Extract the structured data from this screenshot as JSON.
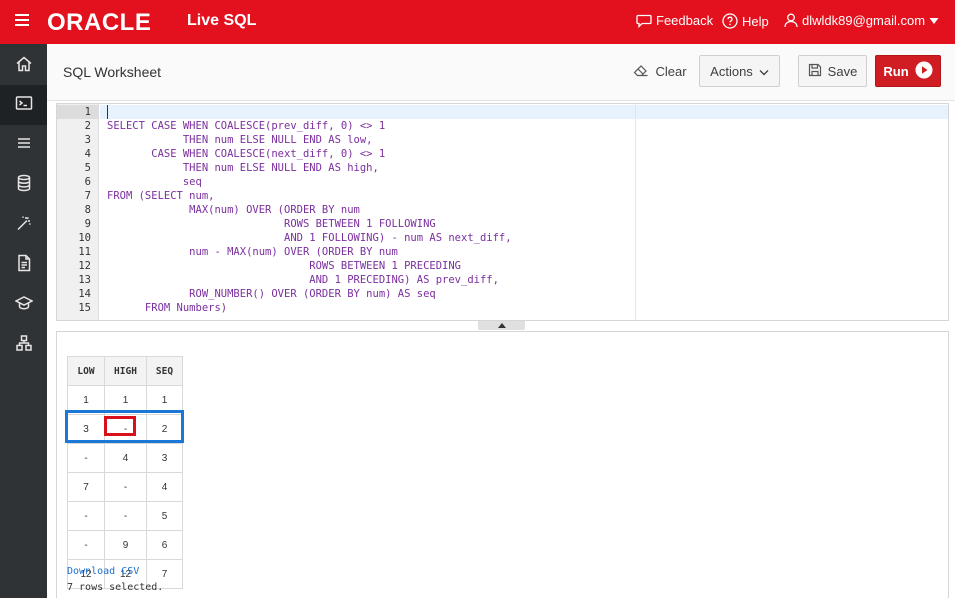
{
  "topbar": {
    "logo": "ORACLE",
    "product": "Live SQL",
    "feedback": "Feedback",
    "help": "Help",
    "user": "dlwldk89@gmail.com"
  },
  "sidebar": {
    "items": [
      "home-icon",
      "terminal-icon",
      "list-icon",
      "database-icon",
      "magic-wand-icon",
      "document-icon",
      "graduation-cap-icon",
      "schema-icon"
    ],
    "active_index": 1
  },
  "header": {
    "title": "SQL Worksheet",
    "clear_label": "Clear",
    "actions_label": "Actions",
    "save_label": "Save",
    "run_label": "Run"
  },
  "editor": {
    "line_numbers": [
      "1",
      "2",
      "3",
      "4",
      "5",
      "6",
      "7",
      "8",
      "9",
      "10",
      "11",
      "12",
      "13",
      "14",
      "15"
    ],
    "lines": [
      "",
      "SELECT CASE WHEN COALESCE(prev_diff, 0) <> 1",
      "            THEN num ELSE NULL END AS low,",
      "       CASE WHEN COALESCE(next_diff, 0) <> 1",
      "            THEN num ELSE NULL END AS high,",
      "            seq",
      "FROM (SELECT num,",
      "             MAX(num) OVER (ORDER BY num",
      "                            ROWS BETWEEN 1 FOLLOWING",
      "                            AND 1 FOLLOWING) - num AS next_diff,",
      "             num - MAX(num) OVER (ORDER BY num",
      "                                ROWS BETWEEN 1 PRECEDING",
      "                                AND 1 PRECEDING) AS prev_diff,",
      "             ROW_NUMBER() OVER (ORDER BY num) AS seq",
      "      FROM Numbers)"
    ]
  },
  "results": {
    "columns": [
      "LOW",
      "HIGH",
      "SEQ"
    ],
    "rows": [
      [
        "1",
        "1",
        "1"
      ],
      [
        "3",
        "-",
        "2"
      ],
      [
        "-",
        "4",
        "3"
      ],
      [
        "7",
        "-",
        "4"
      ],
      [
        "-",
        "-",
        "5"
      ],
      [
        "-",
        "9",
        "6"
      ],
      [
        "12",
        "12",
        "7"
      ]
    ],
    "download_label": "Download CSV",
    "rows_selected": "7 rows selected."
  },
  "colors": {
    "brand_red": "#e3111d",
    "run_red": "#d01d24",
    "sidebar": "#2f3336",
    "keyword": "#b000b0",
    "highlight_row": "#1a78d6",
    "highlight_cell": "#d8111c"
  }
}
